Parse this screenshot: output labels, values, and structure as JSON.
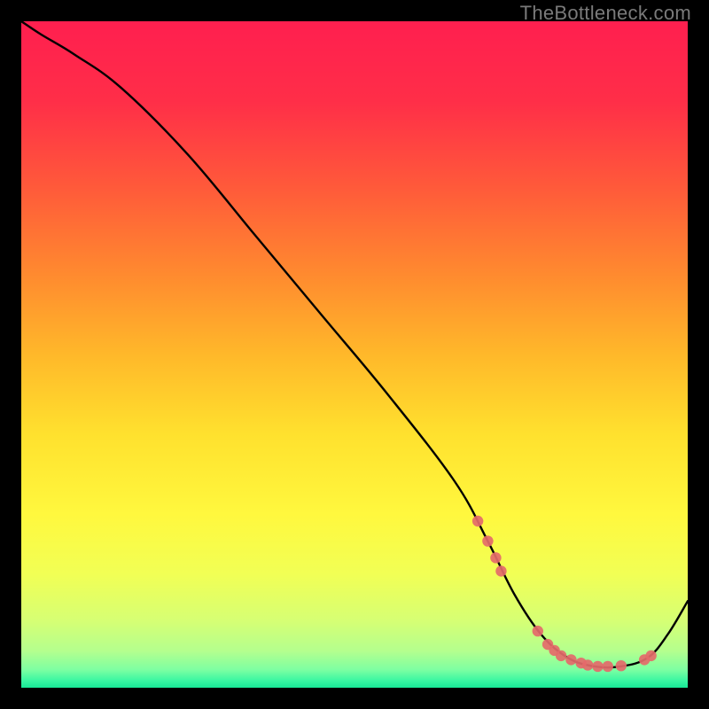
{
  "watermark": "TheBottleneck.com",
  "chart_data": {
    "type": "line",
    "title": "",
    "xlabel": "",
    "ylabel": "",
    "xlim": [
      0,
      100
    ],
    "ylim": [
      0,
      100
    ],
    "series": [
      {
        "name": "curve",
        "x": [
          0,
          3,
          8,
          15,
          25,
          35,
          45,
          55,
          65,
          70,
          74,
          78,
          82,
          86,
          90,
          94,
          97,
          100
        ],
        "y": [
          100,
          98,
          95,
          90,
          80,
          68,
          56,
          44,
          31,
          22,
          14,
          8,
          4.5,
          3.2,
          3.2,
          4.5,
          8,
          13
        ]
      },
      {
        "name": "highlight-points",
        "x": [
          68.5,
          70.0,
          71.2,
          72.0,
          77.5,
          79.0,
          80.0,
          81.0,
          82.5,
          84.0,
          85.0,
          86.5,
          88.0,
          90.0,
          93.5,
          94.5
        ],
        "y": [
          25.0,
          22.0,
          19.5,
          17.5,
          8.5,
          6.5,
          5.6,
          4.8,
          4.2,
          3.7,
          3.4,
          3.2,
          3.2,
          3.3,
          4.2,
          4.8
        ]
      }
    ],
    "gradient_stops": [
      {
        "offset": 0.0,
        "color": "#ff1f4f"
      },
      {
        "offset": 0.12,
        "color": "#ff2e48"
      },
      {
        "offset": 0.25,
        "color": "#ff5a3a"
      },
      {
        "offset": 0.38,
        "color": "#ff8a2f"
      },
      {
        "offset": 0.5,
        "color": "#ffb82a"
      },
      {
        "offset": 0.62,
        "color": "#ffe12e"
      },
      {
        "offset": 0.74,
        "color": "#fff83e"
      },
      {
        "offset": 0.83,
        "color": "#f1ff55"
      },
      {
        "offset": 0.9,
        "color": "#d6ff74"
      },
      {
        "offset": 0.945,
        "color": "#b4ff8e"
      },
      {
        "offset": 0.973,
        "color": "#7dffa2"
      },
      {
        "offset": 0.99,
        "color": "#37f6a2"
      },
      {
        "offset": 1.0,
        "color": "#18e896"
      }
    ]
  }
}
